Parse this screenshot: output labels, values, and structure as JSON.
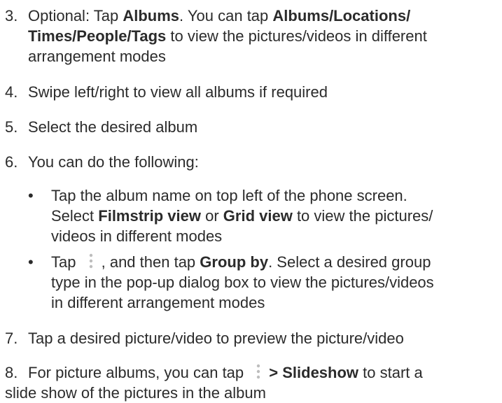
{
  "steps": [
    {
      "num": "3.",
      "pre": "Optional: Tap ",
      "b1": "Albums",
      "mid": ". You can tap ",
      "b2": "Albums/Locations/",
      "b3": "Times/People/Tags",
      "post": " to view the pictures/videos in different",
      "post2": "arrangement modes"
    },
    {
      "num": "4.",
      "text": "Swipe left/right to view all albums if required"
    },
    {
      "num": "5.",
      "text": "Select the desired album"
    },
    {
      "num": "6.",
      "text": "You can do the following:"
    },
    {
      "num": "7.",
      "text": "Tap a desired picture/video to preview the picture/video"
    },
    {
      "num": "8.",
      "pre": "For picture albums, you can tap ",
      "bold": "> Slideshow",
      "post": " to start a",
      "post2": "slide show of the pictures in the album"
    }
  ],
  "bullets": [
    {
      "dot": "•",
      "l1": "Tap the album name on top left of the phone screen.",
      "l2pre": "Select ",
      "b1": "Filmstrip view",
      "l2mid": " or ",
      "b2": "Grid view",
      "l2post": " to view the pictures/",
      "l3": "videos in different modes"
    },
    {
      "dot": "•",
      "pre": "Tap ",
      "comma": ",",
      "mid": " and then tap ",
      "bold": "Group by",
      "post": ". Select a desired group",
      "l2": "type in the pop-up dialog box to view the pictures/videos",
      "l3": "in different arrangement modes"
    }
  ],
  "icons": [
    "more-menu-icon"
  ]
}
